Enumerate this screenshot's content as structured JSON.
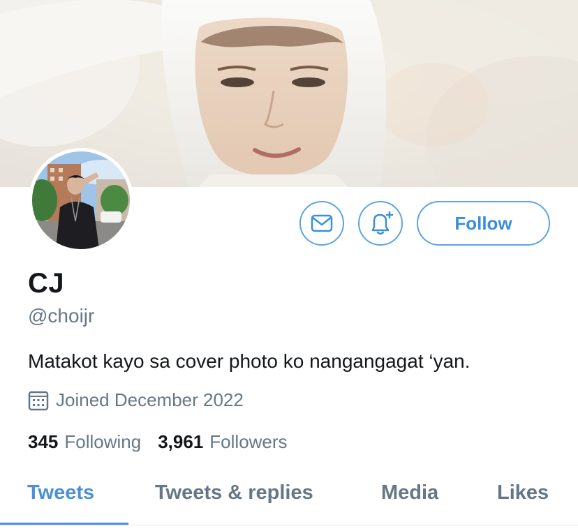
{
  "profile": {
    "name": "CJ",
    "handle": "@choijr",
    "bio": "Matakot kayo sa cover photo ko nangangagat ‘yan.",
    "joined": "Joined December 2022"
  },
  "actions": {
    "follow_label": "Follow",
    "message_icon": "envelope-icon",
    "notify_icon": "bell-plus-icon"
  },
  "stats": {
    "following_count": "345",
    "following_label": "Following",
    "followers_count": "3,961",
    "followers_label": "Followers"
  },
  "tabs": [
    {
      "label": "Tweets",
      "active": true
    },
    {
      "label": "Tweets & replies",
      "active": false
    },
    {
      "label": "Media",
      "active": false
    },
    {
      "label": "Likes",
      "active": false
    }
  ],
  "colors": {
    "accent": "#4a90d9",
    "button_border": "#5aa3e6",
    "secondary_text": "#657786",
    "primary_text": "#14171a"
  }
}
